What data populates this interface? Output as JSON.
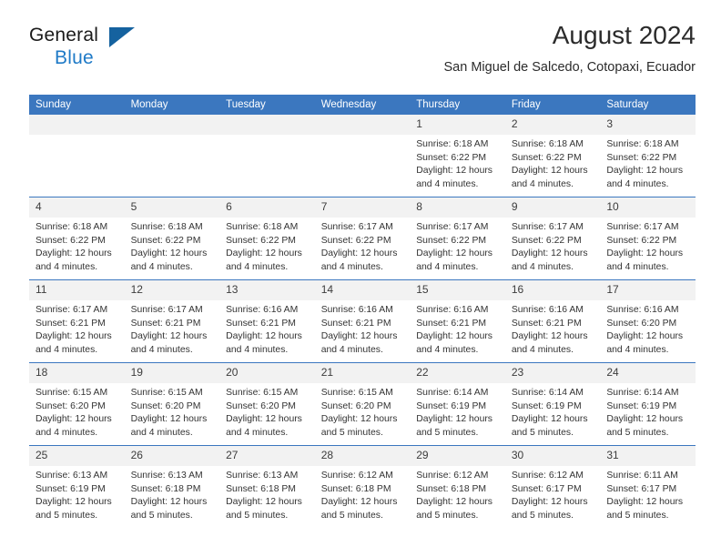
{
  "brand": {
    "line1": "General",
    "line2": "Blue",
    "logo_icon": "triangle-logo-icon"
  },
  "header": {
    "title": "August 2024",
    "subtitle": "San Miguel de Salcedo, Cotopaxi, Ecuador"
  },
  "colors": {
    "header_blue": "#3B77BF",
    "brand_blue": "#1F7AC7",
    "logo_blue": "#15629F",
    "daynum_band": "#F2F2F2"
  },
  "weekdays": [
    "Sunday",
    "Monday",
    "Tuesday",
    "Wednesday",
    "Thursday",
    "Friday",
    "Saturday"
  ],
  "weeks": [
    [
      {
        "day": "",
        "empty": true
      },
      {
        "day": "",
        "empty": true
      },
      {
        "day": "",
        "empty": true
      },
      {
        "day": "",
        "empty": true
      },
      {
        "day": "1",
        "sunrise": "Sunrise: 6:18 AM",
        "sunset": "Sunset: 6:22 PM",
        "daylight1": "Daylight: 12 hours",
        "daylight2": "and 4 minutes."
      },
      {
        "day": "2",
        "sunrise": "Sunrise: 6:18 AM",
        "sunset": "Sunset: 6:22 PM",
        "daylight1": "Daylight: 12 hours",
        "daylight2": "and 4 minutes."
      },
      {
        "day": "3",
        "sunrise": "Sunrise: 6:18 AM",
        "sunset": "Sunset: 6:22 PM",
        "daylight1": "Daylight: 12 hours",
        "daylight2": "and 4 minutes."
      }
    ],
    [
      {
        "day": "4",
        "sunrise": "Sunrise: 6:18 AM",
        "sunset": "Sunset: 6:22 PM",
        "daylight1": "Daylight: 12 hours",
        "daylight2": "and 4 minutes."
      },
      {
        "day": "5",
        "sunrise": "Sunrise: 6:18 AM",
        "sunset": "Sunset: 6:22 PM",
        "daylight1": "Daylight: 12 hours",
        "daylight2": "and 4 minutes."
      },
      {
        "day": "6",
        "sunrise": "Sunrise: 6:18 AM",
        "sunset": "Sunset: 6:22 PM",
        "daylight1": "Daylight: 12 hours",
        "daylight2": "and 4 minutes."
      },
      {
        "day": "7",
        "sunrise": "Sunrise: 6:17 AM",
        "sunset": "Sunset: 6:22 PM",
        "daylight1": "Daylight: 12 hours",
        "daylight2": "and 4 minutes."
      },
      {
        "day": "8",
        "sunrise": "Sunrise: 6:17 AM",
        "sunset": "Sunset: 6:22 PM",
        "daylight1": "Daylight: 12 hours",
        "daylight2": "and 4 minutes."
      },
      {
        "day": "9",
        "sunrise": "Sunrise: 6:17 AM",
        "sunset": "Sunset: 6:22 PM",
        "daylight1": "Daylight: 12 hours",
        "daylight2": "and 4 minutes."
      },
      {
        "day": "10",
        "sunrise": "Sunrise: 6:17 AM",
        "sunset": "Sunset: 6:22 PM",
        "daylight1": "Daylight: 12 hours",
        "daylight2": "and 4 minutes."
      }
    ],
    [
      {
        "day": "11",
        "sunrise": "Sunrise: 6:17 AM",
        "sunset": "Sunset: 6:21 PM",
        "daylight1": "Daylight: 12 hours",
        "daylight2": "and 4 minutes."
      },
      {
        "day": "12",
        "sunrise": "Sunrise: 6:17 AM",
        "sunset": "Sunset: 6:21 PM",
        "daylight1": "Daylight: 12 hours",
        "daylight2": "and 4 minutes."
      },
      {
        "day": "13",
        "sunrise": "Sunrise: 6:16 AM",
        "sunset": "Sunset: 6:21 PM",
        "daylight1": "Daylight: 12 hours",
        "daylight2": "and 4 minutes."
      },
      {
        "day": "14",
        "sunrise": "Sunrise: 6:16 AM",
        "sunset": "Sunset: 6:21 PM",
        "daylight1": "Daylight: 12 hours",
        "daylight2": "and 4 minutes."
      },
      {
        "day": "15",
        "sunrise": "Sunrise: 6:16 AM",
        "sunset": "Sunset: 6:21 PM",
        "daylight1": "Daylight: 12 hours",
        "daylight2": "and 4 minutes."
      },
      {
        "day": "16",
        "sunrise": "Sunrise: 6:16 AM",
        "sunset": "Sunset: 6:21 PM",
        "daylight1": "Daylight: 12 hours",
        "daylight2": "and 4 minutes."
      },
      {
        "day": "17",
        "sunrise": "Sunrise: 6:16 AM",
        "sunset": "Sunset: 6:20 PM",
        "daylight1": "Daylight: 12 hours",
        "daylight2": "and 4 minutes."
      }
    ],
    [
      {
        "day": "18",
        "sunrise": "Sunrise: 6:15 AM",
        "sunset": "Sunset: 6:20 PM",
        "daylight1": "Daylight: 12 hours",
        "daylight2": "and 4 minutes."
      },
      {
        "day": "19",
        "sunrise": "Sunrise: 6:15 AM",
        "sunset": "Sunset: 6:20 PM",
        "daylight1": "Daylight: 12 hours",
        "daylight2": "and 4 minutes."
      },
      {
        "day": "20",
        "sunrise": "Sunrise: 6:15 AM",
        "sunset": "Sunset: 6:20 PM",
        "daylight1": "Daylight: 12 hours",
        "daylight2": "and 4 minutes."
      },
      {
        "day": "21",
        "sunrise": "Sunrise: 6:15 AM",
        "sunset": "Sunset: 6:20 PM",
        "daylight1": "Daylight: 12 hours",
        "daylight2": "and 5 minutes."
      },
      {
        "day": "22",
        "sunrise": "Sunrise: 6:14 AM",
        "sunset": "Sunset: 6:19 PM",
        "daylight1": "Daylight: 12 hours",
        "daylight2": "and 5 minutes."
      },
      {
        "day": "23",
        "sunrise": "Sunrise: 6:14 AM",
        "sunset": "Sunset: 6:19 PM",
        "daylight1": "Daylight: 12 hours",
        "daylight2": "and 5 minutes."
      },
      {
        "day": "24",
        "sunrise": "Sunrise: 6:14 AM",
        "sunset": "Sunset: 6:19 PM",
        "daylight1": "Daylight: 12 hours",
        "daylight2": "and 5 minutes."
      }
    ],
    [
      {
        "day": "25",
        "sunrise": "Sunrise: 6:13 AM",
        "sunset": "Sunset: 6:19 PM",
        "daylight1": "Daylight: 12 hours",
        "daylight2": "and 5 minutes."
      },
      {
        "day": "26",
        "sunrise": "Sunrise: 6:13 AM",
        "sunset": "Sunset: 6:18 PM",
        "daylight1": "Daylight: 12 hours",
        "daylight2": "and 5 minutes."
      },
      {
        "day": "27",
        "sunrise": "Sunrise: 6:13 AM",
        "sunset": "Sunset: 6:18 PM",
        "daylight1": "Daylight: 12 hours",
        "daylight2": "and 5 minutes."
      },
      {
        "day": "28",
        "sunrise": "Sunrise: 6:12 AM",
        "sunset": "Sunset: 6:18 PM",
        "daylight1": "Daylight: 12 hours",
        "daylight2": "and 5 minutes."
      },
      {
        "day": "29",
        "sunrise": "Sunrise: 6:12 AM",
        "sunset": "Sunset: 6:18 PM",
        "daylight1": "Daylight: 12 hours",
        "daylight2": "and 5 minutes."
      },
      {
        "day": "30",
        "sunrise": "Sunrise: 6:12 AM",
        "sunset": "Sunset: 6:17 PM",
        "daylight1": "Daylight: 12 hours",
        "daylight2": "and 5 minutes."
      },
      {
        "day": "31",
        "sunrise": "Sunrise: 6:11 AM",
        "sunset": "Sunset: 6:17 PM",
        "daylight1": "Daylight: 12 hours",
        "daylight2": "and 5 minutes."
      }
    ]
  ]
}
